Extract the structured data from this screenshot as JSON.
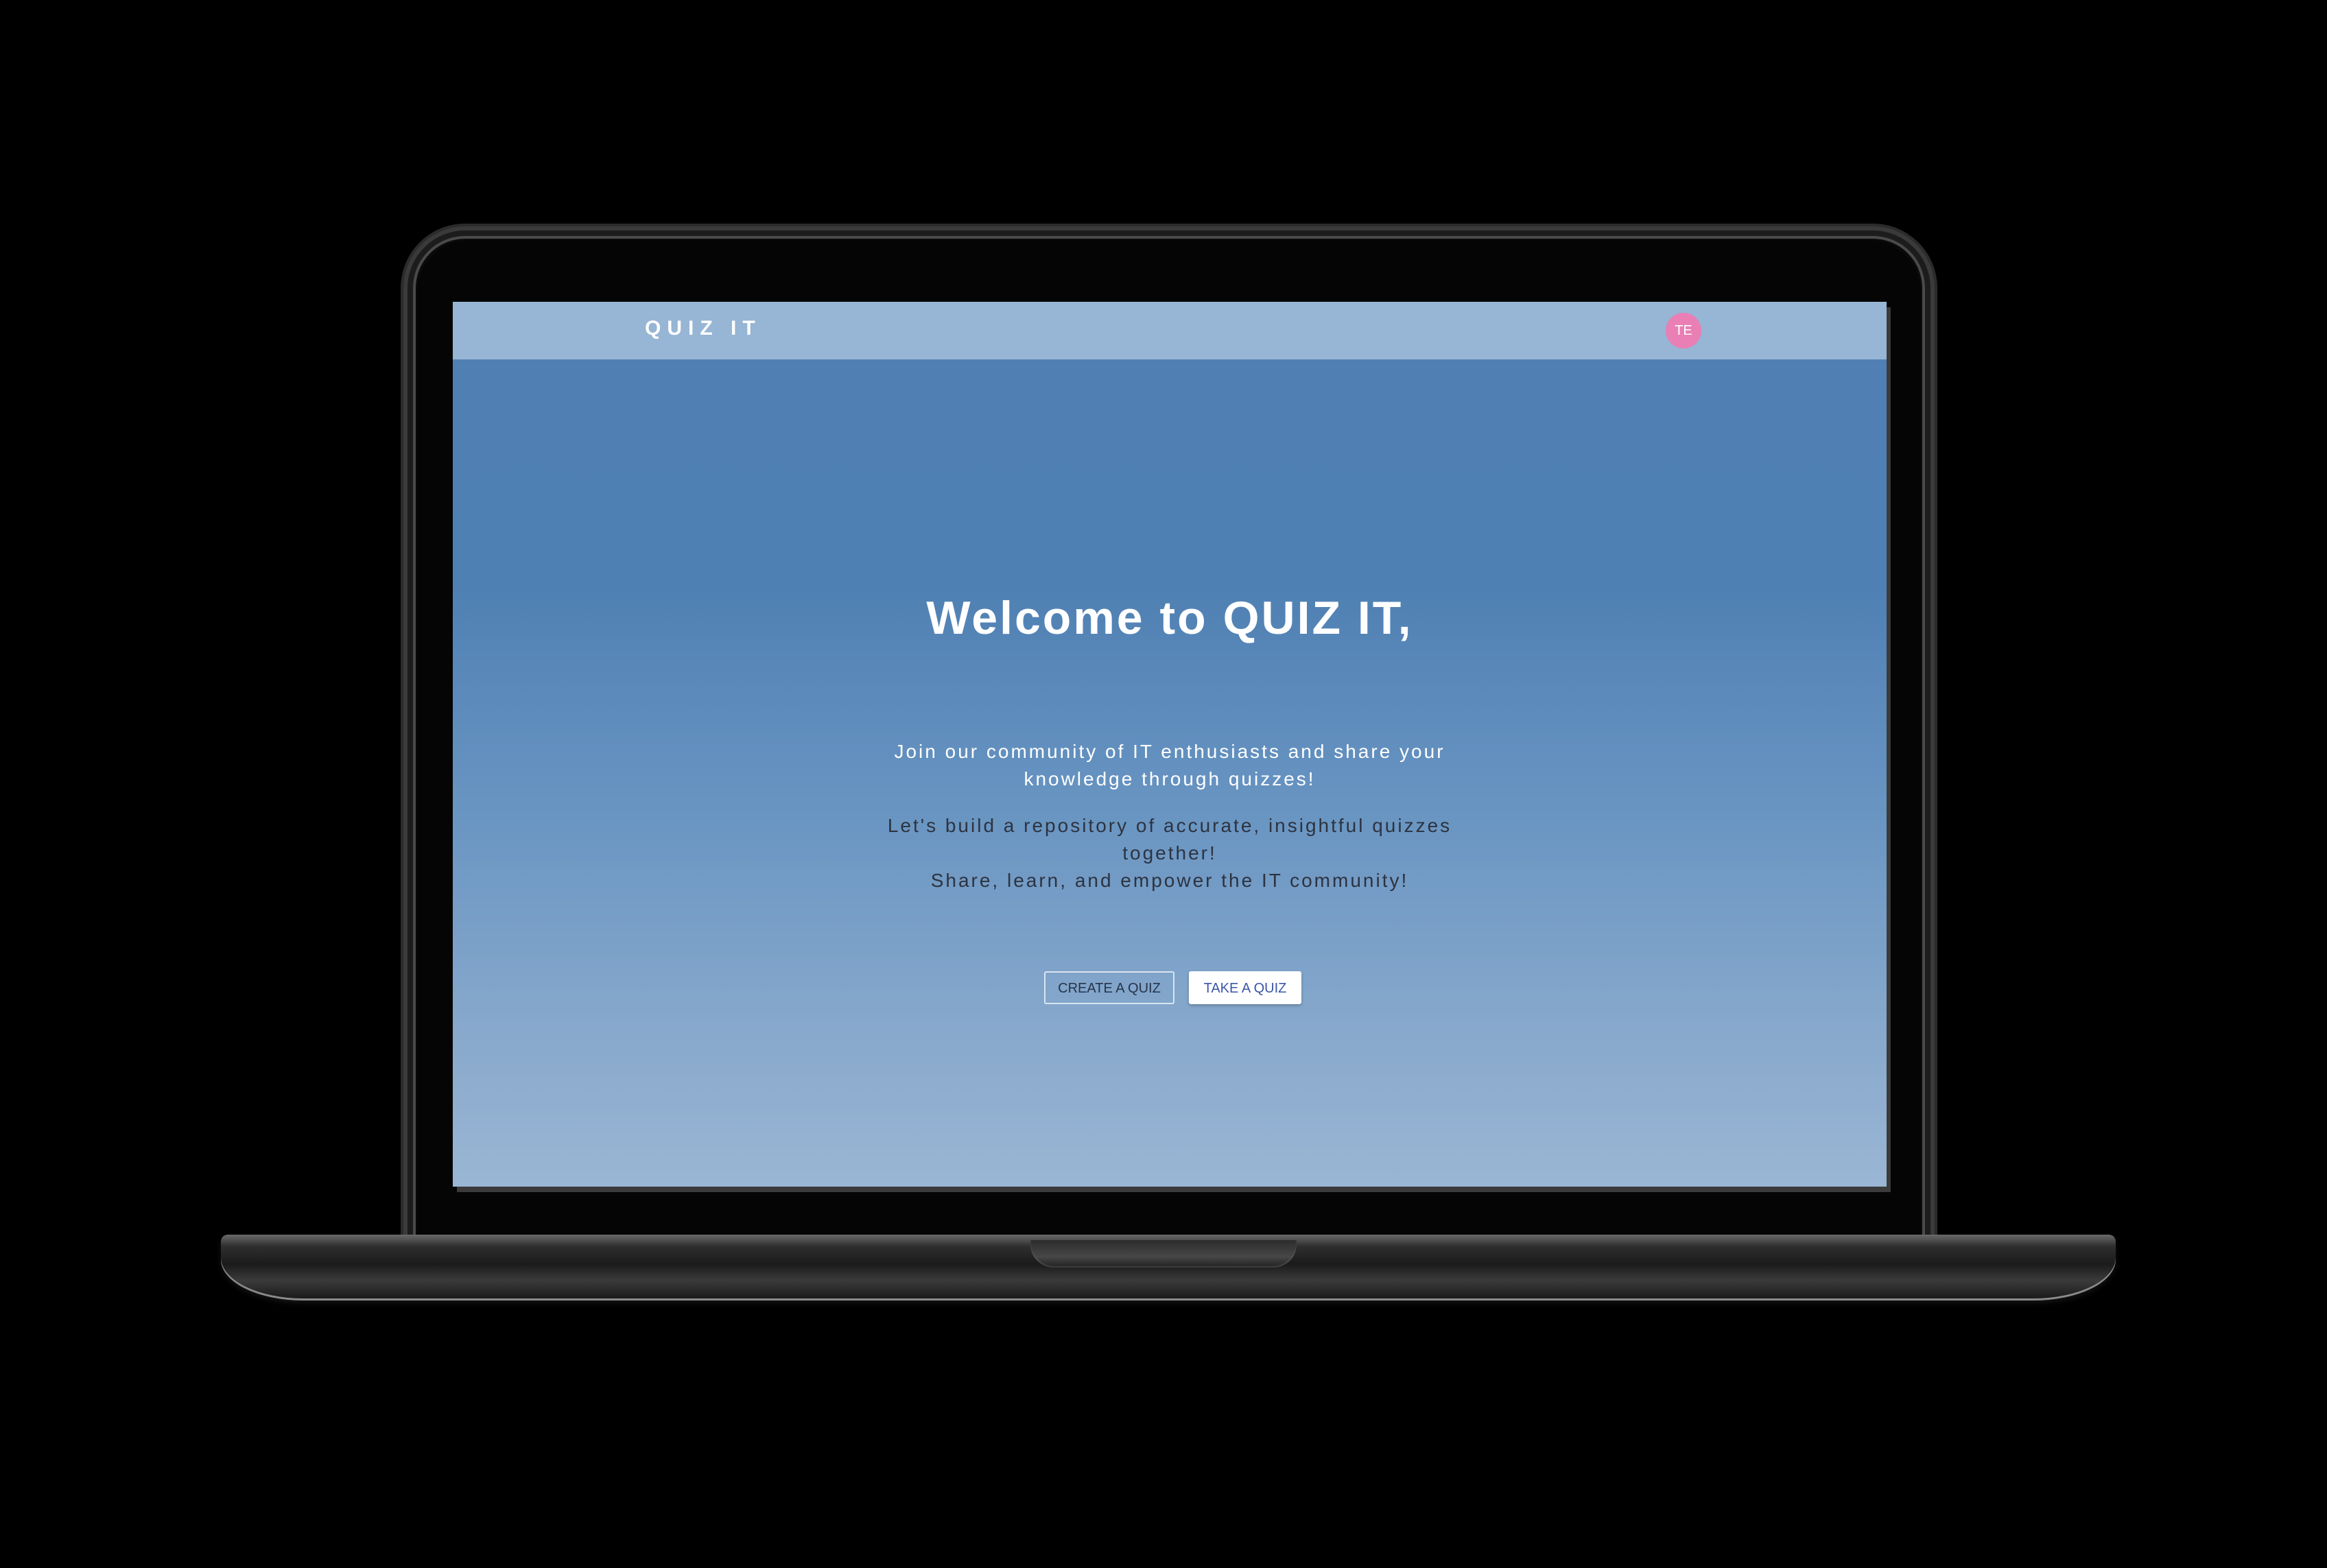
{
  "navbar": {
    "brand": "QUIZ IT",
    "avatar_initials": "TE",
    "avatar_color": "#e97fb5"
  },
  "hero": {
    "title": "Welcome to QUIZ IT,",
    "intro": "Join our community of IT enthusiasts and share your knowledge through quizzes!",
    "tagline_line1": "Let's build a repository of accurate, insightful quizzes together!",
    "tagline_line2": "Share, learn, and empower the IT community!"
  },
  "actions": {
    "create_label": "CREATE A QUIZ",
    "take_label": "TAKE A QUIZ"
  },
  "colors": {
    "navbar_bg": "#97b5d4",
    "hero_top": "#5080b3",
    "hero_bottom": "#9ab6d4",
    "take_button_text": "#3b56a8"
  }
}
